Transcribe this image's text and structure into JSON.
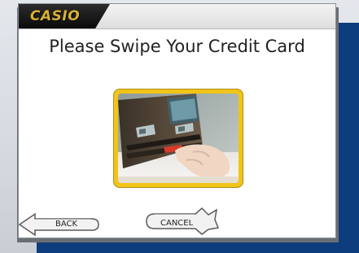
{
  "header": {
    "logo_text": "CASIO"
  },
  "main": {
    "heading": "Please Swipe Your Credit Card",
    "illustration_icon": "card-swipe-photo"
  },
  "buttons": {
    "back_label": "BACK",
    "cancel_label": "CANCEL"
  },
  "colors": {
    "frame_gold": "#f0c419",
    "logo_gold": "#d9b233",
    "backdrop_blue": "#0d3d7d"
  }
}
